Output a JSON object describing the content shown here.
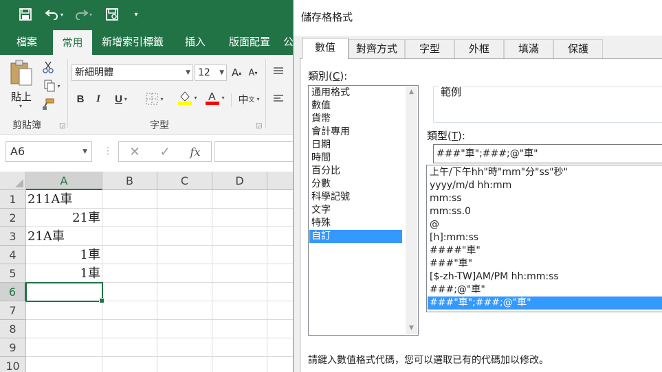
{
  "excel": {
    "tabs": [
      "檔案",
      "常用",
      "新增索引標籤",
      "插入",
      "版面配置",
      "公"
    ],
    "active_tab": "常用",
    "ribbon": {
      "paste_label": "貼上",
      "clipboard_group": "剪貼簿",
      "font_group": "字型",
      "font_name": "新細明體",
      "font_size": "12",
      "bold": "B",
      "italic": "I",
      "underline": "U",
      "grow_font": "A",
      "shrink_font": "A",
      "phonetic": "中",
      "phonetic_sub": "文"
    },
    "name_box": "A6",
    "fx_label": "fx",
    "columns": [
      "A",
      "B",
      "C",
      "D"
    ],
    "rows": [
      {
        "num": "1",
        "a": "211A車",
        "align": "left"
      },
      {
        "num": "2",
        "a": "21車",
        "align": "right"
      },
      {
        "num": "3",
        "a": "21A車",
        "align": "left"
      },
      {
        "num": "4",
        "a": "1車",
        "align": "right"
      },
      {
        "num": "5",
        "a": "1車",
        "align": "right"
      },
      {
        "num": "6",
        "a": "",
        "align": "left"
      },
      {
        "num": "7",
        "a": "",
        "align": "left"
      },
      {
        "num": "8",
        "a": "",
        "align": "left"
      },
      {
        "num": "9",
        "a": "",
        "align": "left"
      },
      {
        "num": "10",
        "a": "",
        "align": "left"
      }
    ],
    "active_cell": "A6",
    "colors": {
      "brand": "#217346"
    }
  },
  "dialog": {
    "title": "儲存格格式",
    "tabs": [
      "數值",
      "對齊方式",
      "字型",
      "外框",
      "填滿",
      "保護"
    ],
    "active_tab": "數值",
    "category_label": "類別(",
    "category_hotkey": "C",
    "category_label_end": "):",
    "categories": [
      "通用格式",
      "數值",
      "貨幣",
      "會計專用",
      "日期",
      "時間",
      "百分比",
      "分數",
      "科學記號",
      "文字",
      "特殊",
      "自訂"
    ],
    "selected_category": "自訂",
    "sample_label": "範例",
    "type_label": "類型(",
    "type_hotkey": "T",
    "type_label_end": "):",
    "type_value": "###\"車\";###;@\"車\"",
    "formats": [
      "上午/下午hh\"時\"mm\"分\"ss\"秒\"",
      "yyyy/m/d hh:mm",
      "mm:ss",
      "mm:ss.0",
      "@",
      "[h]:mm:ss",
      "####\"車\"",
      "###\"車\"",
      "[$-zh-TW]AM/PM hh:mm:ss",
      "###;@\"車\"",
      "###\"車\";###;@\"車\""
    ],
    "selected_format": "###\"車\";###;@\"車\"",
    "hint": "請鍵入數值格式代碼，您可以選取已有的代碼加以修改。",
    "colors": {
      "selection": "#3399ff"
    }
  }
}
